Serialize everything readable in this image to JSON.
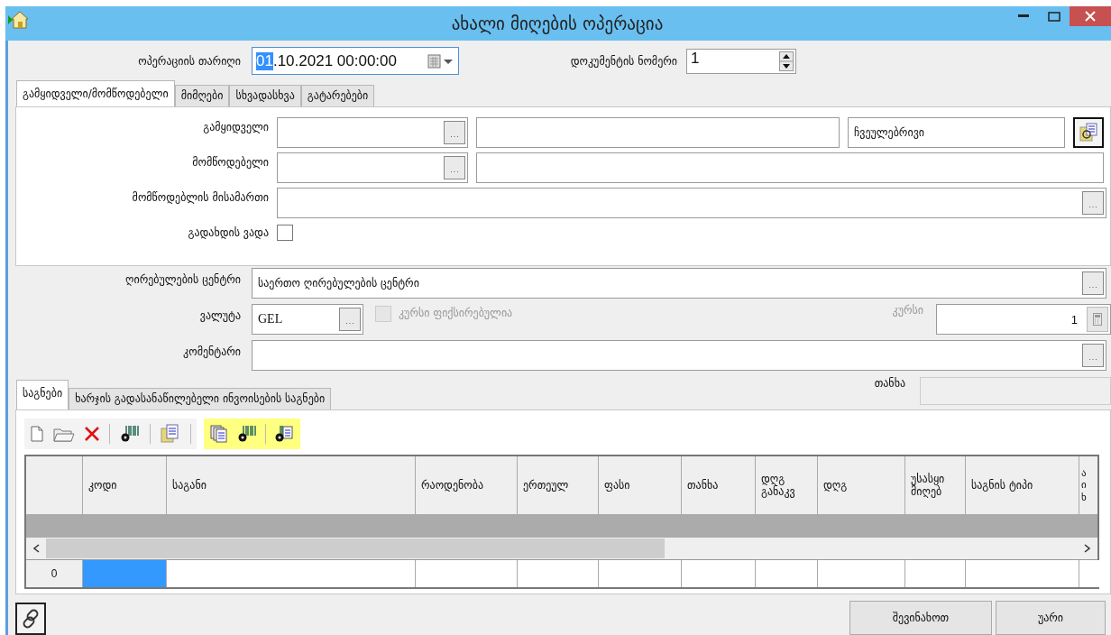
{
  "window": {
    "title": "ახალი მიღების ოპერაცია"
  },
  "header": {
    "date": {
      "label": "ოპერაციის თარიღი",
      "selected": "01",
      "rest": ".10.2021 00:00:00"
    },
    "doc_number": {
      "label": "დოკუმენტის ნომერი",
      "value": "1"
    }
  },
  "tabs": [
    {
      "label": "გამყიდველი/მომწოდებელი",
      "selected": true
    },
    {
      "label": "მიმღები",
      "selected": false
    },
    {
      "label": "სხვადასხვა",
      "selected": false
    },
    {
      "label": "გატარებები",
      "selected": false
    }
  ],
  "seller_panel": {
    "seller": {
      "label": "გამყიდველი",
      "type_value": "ჩვეულებრივი"
    },
    "supplier": {
      "label": "მომწოდებელი"
    },
    "address": {
      "label": "მომწოდებლის მისამართი"
    },
    "deadline": {
      "label": "გადახდის ვადა",
      "checked": false
    }
  },
  "cost_center": {
    "label": "ღირებულების ცენტრი",
    "value": "საერთო ღირებულების ცენტრი"
  },
  "currency": {
    "label": "ვალუტა",
    "value": "GEL",
    "fixed_rate": {
      "label": "კურსი ფიქსირებულია",
      "checked": false,
      "disabled": true
    },
    "rate": {
      "label": "კურსი",
      "value": "1"
    }
  },
  "comment": {
    "label": "კომენტარი"
  },
  "item_tabs": [
    {
      "label": "საგნები",
      "selected": true
    },
    {
      "label": "ხარჯის გადასანაწილებელი ინვოისების საგნები",
      "selected": false
    }
  ],
  "total": {
    "label": "თანხა"
  },
  "table": {
    "columns": [
      "კოდი",
      "საგანი",
      "რაოდენობა",
      "ერთეულ",
      "ფასი",
      "თანხა",
      "დღგ განაკვ",
      "დღგ",
      "უსასყი მიღებ",
      "საგნის ტიპი",
      "ა ი ხ"
    ],
    "rows": [
      {
        "number": "0"
      }
    ]
  },
  "buttons": [
    {
      "label": "შევინახოთ"
    },
    {
      "label": "უარი"
    }
  ]
}
